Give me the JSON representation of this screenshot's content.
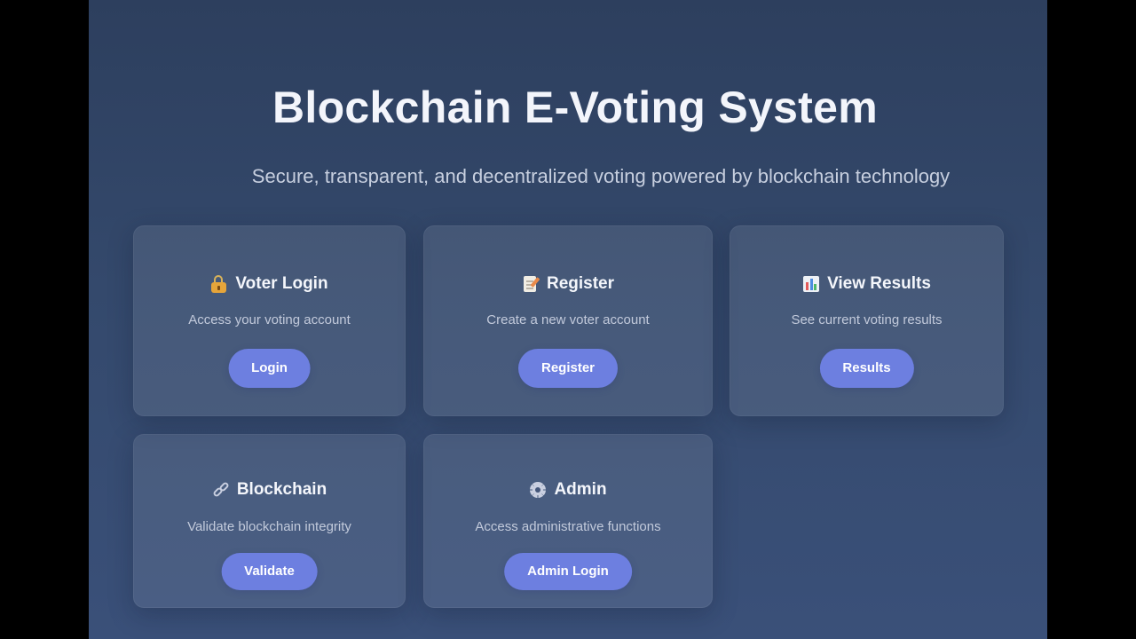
{
  "header": {
    "title": "Blockchain E-Voting System",
    "subtitle": "Secure, transparent, and decentralized voting powered by blockchain technology"
  },
  "cards": [
    {
      "icon": "lock-icon",
      "title": "Voter Login",
      "description": "Access your voting account",
      "button": "Login"
    },
    {
      "icon": "memo-icon",
      "title": "Register",
      "description": "Create a new voter account",
      "button": "Register"
    },
    {
      "icon": "bar-chart-icon",
      "title": "View Results",
      "description": "See current voting results",
      "button": "Results"
    },
    {
      "icon": "link-icon",
      "title": "Blockchain",
      "description": "Validate blockchain integrity",
      "button": "Validate"
    },
    {
      "icon": "gear-icon",
      "title": "Admin",
      "description": "Access administrative functions",
      "button": "Admin Login"
    }
  ],
  "colors": {
    "background": "#34496c",
    "button": "#6d7fe0",
    "title_text": "#f3f5fb"
  }
}
